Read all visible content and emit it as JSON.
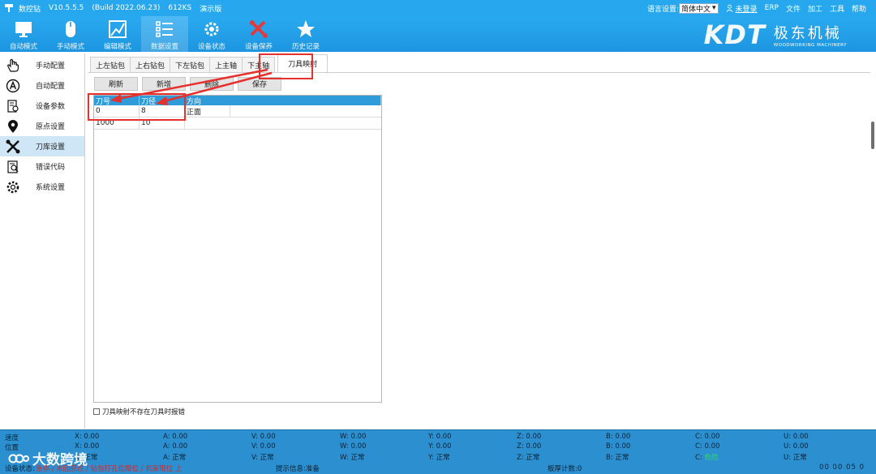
{
  "titlebar": {
    "app_name": "数控钻",
    "version": "V10.5.5.5",
    "build": "(Build 2022.06.23)",
    "code": "612KS",
    "mode": "演示版",
    "lang_label": "语言设置:",
    "lang_value": "简体中文",
    "user": "未登录",
    "menu": [
      "ERP",
      "文件",
      "加工",
      "工具",
      "帮助"
    ]
  },
  "toolbar": {
    "buttons": [
      {
        "label": "自动模式",
        "icon": "monitor-icon"
      },
      {
        "label": "手动模式",
        "icon": "mouse-icon"
      },
      {
        "label": "编辑模式",
        "icon": "image-edit-icon"
      },
      {
        "label": "数据设置",
        "icon": "list-icon"
      },
      {
        "label": "设备状态",
        "icon": "gear-chip-icon"
      },
      {
        "label": "设备保养",
        "icon": "tools-icon"
      },
      {
        "label": "历史记录",
        "icon": "star-icon"
      }
    ],
    "brand_logo": "KDT",
    "brand_cn": "极东机械",
    "brand_en": "WOODWORKING MACHINERY"
  },
  "sidebar": {
    "items": [
      {
        "label": "手动配置",
        "icon": "hand-icon"
      },
      {
        "label": "自动配置",
        "icon": "auto-a-icon"
      },
      {
        "label": "设备参数",
        "icon": "device-params-icon"
      },
      {
        "label": "原点设置",
        "icon": "location-pin-icon"
      },
      {
        "label": "刀库设置",
        "icon": "tools-icon"
      },
      {
        "label": "错误代码",
        "icon": "error-doc-icon"
      },
      {
        "label": "系统设置",
        "icon": "gear-icon"
      }
    ]
  },
  "tabs": [
    "上左钻包",
    "上右钻包",
    "下左钻包",
    "上主轴",
    "下主轴",
    "刀具映射"
  ],
  "actions": [
    "刷新",
    "新增",
    "删除",
    "保存"
  ],
  "table": {
    "headers": [
      "刀号",
      "刀径",
      "方向"
    ],
    "rows": [
      [
        "0",
        "8",
        "正面"
      ],
      [
        "1000",
        "10",
        ""
      ]
    ]
  },
  "checkbox_label": "刀具映射不存在刀具时报错",
  "status": {
    "row_labels": [
      "速度",
      "位置",
      "设备状态:"
    ],
    "axes": [
      {
        "speed": "X: 0.00",
        "pos": "X: 0.00",
        "state": "X: 正常"
      },
      {
        "speed": "A: 0.00",
        "pos": "A: 0.00",
        "state": "A: 正常"
      },
      {
        "speed": "V: 0.00",
        "pos": "V: 0.00",
        "state": "V: 正常"
      },
      {
        "speed": "W: 0.00",
        "pos": "W: 0.00",
        "state": "W: 正常"
      },
      {
        "speed": "Y: 0.00",
        "pos": "Y: 0.00",
        "state": "Y: 正常"
      },
      {
        "speed": "Z: 0.00",
        "pos": "Z: 0.00",
        "state": "Z: 正常"
      },
      {
        "speed": "B: 0.00",
        "pos": "B: 0.00",
        "state": "B: 正常"
      },
      {
        "speed": "C: 0.00",
        "pos": "C: 0.00",
        "state_prefix": "C: ",
        "state": "危险"
      },
      {
        "speed": "U: 0.00",
        "pos": "U: 0.00",
        "state": "U: 正常"
      }
    ],
    "device_msg": "急停 / 未回原点 / 钻包打孔位限位 / 机架限位 上",
    "hint": "提示信息:准备",
    "board_count": "板厚计数:0",
    "time": "00 00 05 0"
  },
  "watermark": "大数跨境",
  "colors": {
    "titlebar": "#27a8ee",
    "toolbar": "#1d95e0",
    "table_header": "#2f9bd8",
    "annotation_red": "#e5312d",
    "status_bar": "#2c8fd0"
  }
}
